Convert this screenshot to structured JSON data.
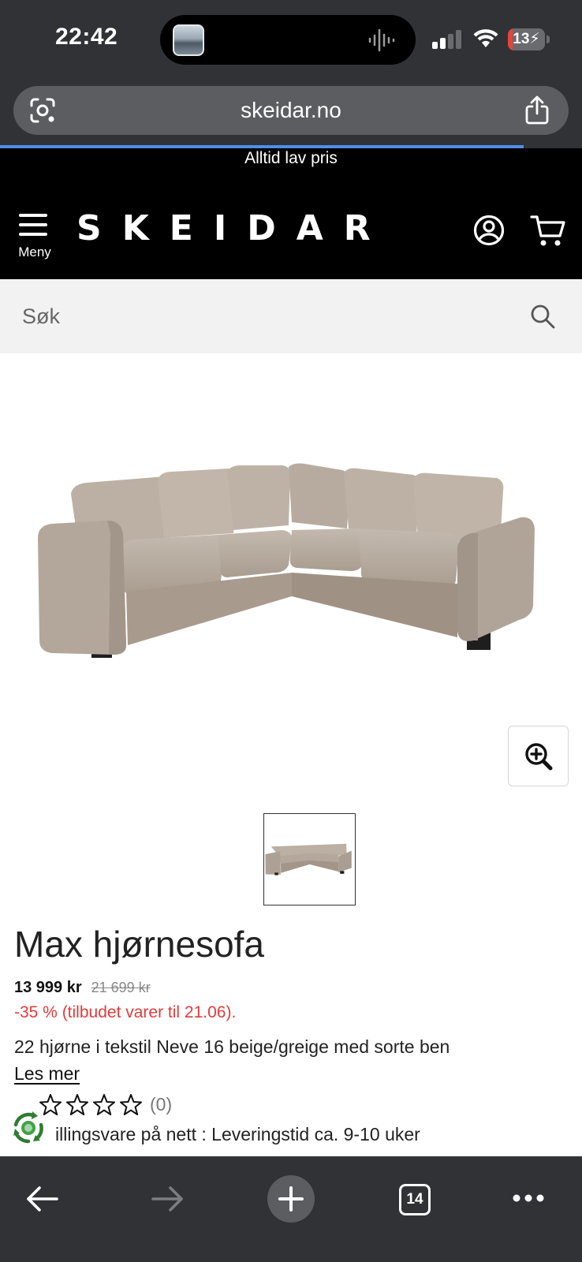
{
  "status_bar": {
    "time": "22:42",
    "battery": "13",
    "battery_level": 0.13,
    "icons": [
      "cellular-signal-icon",
      "wifi-icon",
      "battery-charging-icon"
    ]
  },
  "browser": {
    "url": "skeidar.no",
    "load_progress": 0.9,
    "open_tabs": "14",
    "icons": [
      "google-lens-icon",
      "share-icon",
      "back-arrow-icon",
      "forward-arrow-icon",
      "new-tab-plus-icon",
      "tabs-counter-icon",
      "more-menu-icon"
    ]
  },
  "site": {
    "banner": "Alltid lav pris",
    "menu_label": "Meny",
    "logo": "SKEIDAR",
    "icons": [
      "hamburger-menu-icon",
      "account-icon",
      "cart-icon"
    ],
    "search": {
      "placeholder": "Søk"
    }
  },
  "product": {
    "title": "Max hjørnesofa",
    "price": "13 999 kr",
    "old_price": "21 699 kr",
    "discount": "-35 % (tilbudet varer til 21.06).",
    "description": "22 hjørne i tekstil Neve 16 beige/greige med sorte ben",
    "read_more": "Les mer",
    "rating": 0,
    "rating_count": "(0)",
    "delivery": "illingsvare på nett : Leveringstid ca. 9-10 uker",
    "image_colors": {
      "fabric": "#b9ada1",
      "legs": "#1e1e1e"
    }
  },
  "colors": {
    "header_bg": "#000000",
    "browser_chrome": "#313235",
    "discount_red": "#e33b3b",
    "progress_blue": "#4f8ee8"
  }
}
